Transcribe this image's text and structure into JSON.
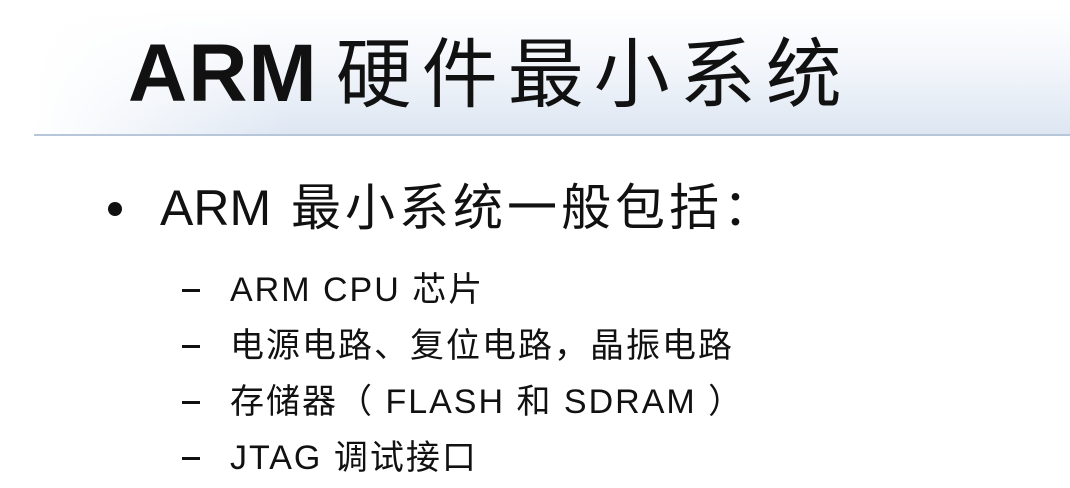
{
  "slide": {
    "title_latin": "ARM",
    "title_cjk": "硬件最小系统",
    "bullet": {
      "latin": "ARM",
      "text": "最小系统一般包括："
    },
    "sub_items": [
      "ARM CPU 芯片",
      "电源电路、复位电路，晶振电路",
      "存储器（ FLASH 和 SDRAM ）",
      "JTAG 调试接口"
    ]
  },
  "colors": {
    "title_band_top": "#ffffff",
    "title_band_bottom": "#dde6f2",
    "title_line": "#b8c6da",
    "text": "#111111"
  }
}
